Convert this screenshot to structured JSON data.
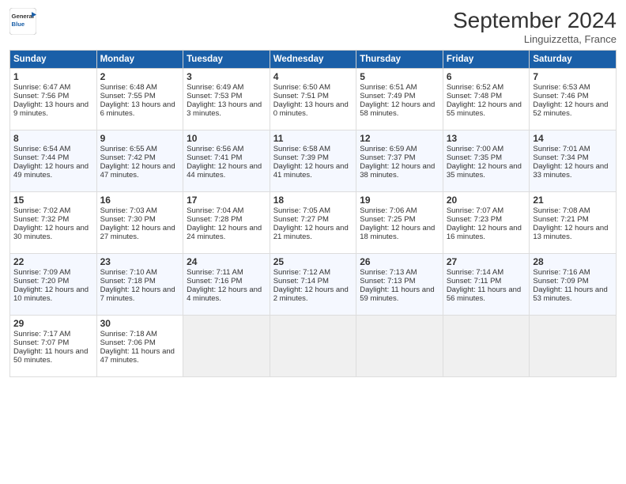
{
  "header": {
    "logo_line1": "General",
    "logo_line2": "Blue",
    "month_title": "September 2024",
    "location": "Linguizzetta, France"
  },
  "days_of_week": [
    "Sunday",
    "Monday",
    "Tuesday",
    "Wednesday",
    "Thursday",
    "Friday",
    "Saturday"
  ],
  "weeks": [
    [
      {
        "day": "1",
        "sunrise": "Sunrise: 6:47 AM",
        "sunset": "Sunset: 7:56 PM",
        "daylight": "Daylight: 13 hours and 9 minutes."
      },
      {
        "day": "2",
        "sunrise": "Sunrise: 6:48 AM",
        "sunset": "Sunset: 7:55 PM",
        "daylight": "Daylight: 13 hours and 6 minutes."
      },
      {
        "day": "3",
        "sunrise": "Sunrise: 6:49 AM",
        "sunset": "Sunset: 7:53 PM",
        "daylight": "Daylight: 13 hours and 3 minutes."
      },
      {
        "day": "4",
        "sunrise": "Sunrise: 6:50 AM",
        "sunset": "Sunset: 7:51 PM",
        "daylight": "Daylight: 13 hours and 0 minutes."
      },
      {
        "day": "5",
        "sunrise": "Sunrise: 6:51 AM",
        "sunset": "Sunset: 7:49 PM",
        "daylight": "Daylight: 12 hours and 58 minutes."
      },
      {
        "day": "6",
        "sunrise": "Sunrise: 6:52 AM",
        "sunset": "Sunset: 7:48 PM",
        "daylight": "Daylight: 12 hours and 55 minutes."
      },
      {
        "day": "7",
        "sunrise": "Sunrise: 6:53 AM",
        "sunset": "Sunset: 7:46 PM",
        "daylight": "Daylight: 12 hours and 52 minutes."
      }
    ],
    [
      {
        "day": "8",
        "sunrise": "Sunrise: 6:54 AM",
        "sunset": "Sunset: 7:44 PM",
        "daylight": "Daylight: 12 hours and 49 minutes."
      },
      {
        "day": "9",
        "sunrise": "Sunrise: 6:55 AM",
        "sunset": "Sunset: 7:42 PM",
        "daylight": "Daylight: 12 hours and 47 minutes."
      },
      {
        "day": "10",
        "sunrise": "Sunrise: 6:56 AM",
        "sunset": "Sunset: 7:41 PM",
        "daylight": "Daylight: 12 hours and 44 minutes."
      },
      {
        "day": "11",
        "sunrise": "Sunrise: 6:58 AM",
        "sunset": "Sunset: 7:39 PM",
        "daylight": "Daylight: 12 hours and 41 minutes."
      },
      {
        "day": "12",
        "sunrise": "Sunrise: 6:59 AM",
        "sunset": "Sunset: 7:37 PM",
        "daylight": "Daylight: 12 hours and 38 minutes."
      },
      {
        "day": "13",
        "sunrise": "Sunrise: 7:00 AM",
        "sunset": "Sunset: 7:35 PM",
        "daylight": "Daylight: 12 hours and 35 minutes."
      },
      {
        "day": "14",
        "sunrise": "Sunrise: 7:01 AM",
        "sunset": "Sunset: 7:34 PM",
        "daylight": "Daylight: 12 hours and 33 minutes."
      }
    ],
    [
      {
        "day": "15",
        "sunrise": "Sunrise: 7:02 AM",
        "sunset": "Sunset: 7:32 PM",
        "daylight": "Daylight: 12 hours and 30 minutes."
      },
      {
        "day": "16",
        "sunrise": "Sunrise: 7:03 AM",
        "sunset": "Sunset: 7:30 PM",
        "daylight": "Daylight: 12 hours and 27 minutes."
      },
      {
        "day": "17",
        "sunrise": "Sunrise: 7:04 AM",
        "sunset": "Sunset: 7:28 PM",
        "daylight": "Daylight: 12 hours and 24 minutes."
      },
      {
        "day": "18",
        "sunrise": "Sunrise: 7:05 AM",
        "sunset": "Sunset: 7:27 PM",
        "daylight": "Daylight: 12 hours and 21 minutes."
      },
      {
        "day": "19",
        "sunrise": "Sunrise: 7:06 AM",
        "sunset": "Sunset: 7:25 PM",
        "daylight": "Daylight: 12 hours and 18 minutes."
      },
      {
        "day": "20",
        "sunrise": "Sunrise: 7:07 AM",
        "sunset": "Sunset: 7:23 PM",
        "daylight": "Daylight: 12 hours and 16 minutes."
      },
      {
        "day": "21",
        "sunrise": "Sunrise: 7:08 AM",
        "sunset": "Sunset: 7:21 PM",
        "daylight": "Daylight: 12 hours and 13 minutes."
      }
    ],
    [
      {
        "day": "22",
        "sunrise": "Sunrise: 7:09 AM",
        "sunset": "Sunset: 7:20 PM",
        "daylight": "Daylight: 12 hours and 10 minutes."
      },
      {
        "day": "23",
        "sunrise": "Sunrise: 7:10 AM",
        "sunset": "Sunset: 7:18 PM",
        "daylight": "Daylight: 12 hours and 7 minutes."
      },
      {
        "day": "24",
        "sunrise": "Sunrise: 7:11 AM",
        "sunset": "Sunset: 7:16 PM",
        "daylight": "Daylight: 12 hours and 4 minutes."
      },
      {
        "day": "25",
        "sunrise": "Sunrise: 7:12 AM",
        "sunset": "Sunset: 7:14 PM",
        "daylight": "Daylight: 12 hours and 2 minutes."
      },
      {
        "day": "26",
        "sunrise": "Sunrise: 7:13 AM",
        "sunset": "Sunset: 7:13 PM",
        "daylight": "Daylight: 11 hours and 59 minutes."
      },
      {
        "day": "27",
        "sunrise": "Sunrise: 7:14 AM",
        "sunset": "Sunset: 7:11 PM",
        "daylight": "Daylight: 11 hours and 56 minutes."
      },
      {
        "day": "28",
        "sunrise": "Sunrise: 7:16 AM",
        "sunset": "Sunset: 7:09 PM",
        "daylight": "Daylight: 11 hours and 53 minutes."
      }
    ],
    [
      {
        "day": "29",
        "sunrise": "Sunrise: 7:17 AM",
        "sunset": "Sunset: 7:07 PM",
        "daylight": "Daylight: 11 hours and 50 minutes."
      },
      {
        "day": "30",
        "sunrise": "Sunrise: 7:18 AM",
        "sunset": "Sunset: 7:06 PM",
        "daylight": "Daylight: 11 hours and 47 minutes."
      },
      null,
      null,
      null,
      null,
      null
    ]
  ]
}
